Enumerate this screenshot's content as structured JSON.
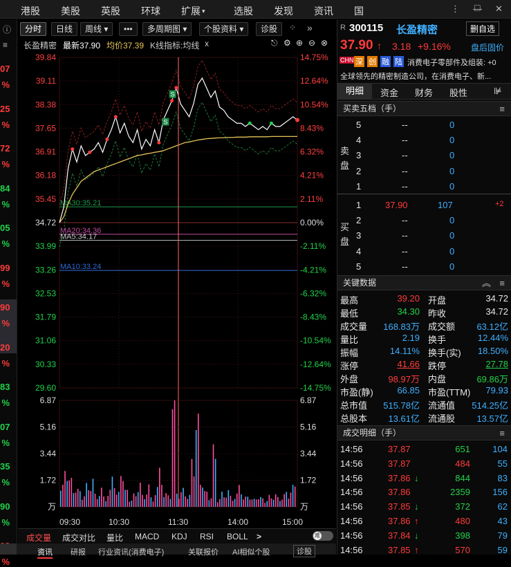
{
  "topnav": {
    "items": [
      "港股",
      "美股",
      "英股",
      "环球",
      "扩展",
      "选股",
      "发现",
      "资讯",
      "国"
    ],
    "window": {
      "min": "—",
      "max": "□",
      "close": "✕"
    }
  },
  "leftstrip": {
    "rows": [
      {
        "main": "07",
        "pct": "%",
        "color": "#ff3b3b"
      },
      {
        "main": "25",
        "pct": "%",
        "color": "#ff3b3b"
      },
      {
        "main": "72",
        "pct": "%",
        "color": "#ff3b3b"
      },
      {
        "main": "84",
        "pct": "%",
        "color": "#22d24a"
      },
      {
        "main": "05",
        "pct": "%",
        "color": "#22d24a"
      },
      {
        "main": "99",
        "pct": "%",
        "color": "#ff3b3b"
      },
      {
        "main": "90",
        "pct": "%",
        "color": "#ff3b3b"
      },
      {
        "main": "20",
        "pct": "%",
        "color": "#ff3b3b"
      },
      {
        "main": "83",
        "pct": "%",
        "color": "#22d24a"
      },
      {
        "main": "07",
        "pct": "%",
        "color": "#22d24a"
      },
      {
        "main": "35",
        "pct": "%",
        "color": "#22d24a"
      },
      {
        "main": "90",
        "pct": "%",
        "color": "#22d24a"
      },
      {
        "main": "03",
        "pct": "%",
        "color": "#ff3b3b"
      }
    ]
  },
  "toolbar": {
    "fenshi": "分时",
    "riline": "日线",
    "zhouxian": "周线 ▾",
    "more": "•••",
    "duozhouqi": "多周期图 ▾",
    "gegu": "个股资料 ▾",
    "zhengu": "诊股",
    "arrows": "⁘",
    "collapse": "»"
  },
  "infobar": {
    "name": "长盈精密",
    "latest": "最新37.90",
    "avg": "均价37.39",
    "indicator": "K线指标:均线",
    "close": "x",
    "icons": [
      "⎋",
      "⚙",
      "⊕",
      "⊖",
      "⊗"
    ]
  },
  "chart_data": {
    "type": "line",
    "title": "长盈精密 分时",
    "prev_close": 34.72,
    "y_left_ticks": [
      "39.84",
      "39.11",
      "38.38",
      "37.65",
      "36.91",
      "36.18",
      "35.45",
      "34.72",
      "33.99",
      "33.26",
      "32.53",
      "31.79",
      "31.06",
      "30.33",
      "29.60"
    ],
    "y_right_ticks": [
      "14.75%",
      "12.64%",
      "10.54%",
      "8.43%",
      "6.32%",
      "4.21%",
      "2.11%",
      "0.00%",
      "-2.11%",
      "-4.21%",
      "-6.32%",
      "-8.43%",
      "-10.54%",
      "-12.64%",
      "-14.75%"
    ],
    "ylim": [
      29.6,
      39.84
    ],
    "x_ticks": [
      "09:30",
      "10:30",
      "11:30",
      "14:00",
      "15:00"
    ],
    "ma_labels": {
      "ma30": "MA30:35.21",
      "ma20": "MA20:34.36",
      "ma5": "MA5:34.17",
      "ma10": "MA10:33.24"
    },
    "ma_values": {
      "ma30": 35.21,
      "ma20": 34.36,
      "ma5": 34.17,
      "ma10": 33.24
    },
    "price": [
      34.72,
      35.2,
      36.4,
      37.0,
      36.6,
      37.1,
      36.8,
      36.9,
      37.0,
      37.2,
      36.9,
      37.3,
      37.6,
      38.0,
      37.5,
      37.8,
      37.4,
      37.2,
      37.6,
      37.0,
      37.3,
      37.1,
      37.6,
      37.2,
      37.9,
      38.2,
      38.5,
      38.9,
      38.4,
      38.2,
      38.0,
      38.4,
      39.0,
      39.2,
      38.9,
      38.6,
      38.8,
      38.3,
      38.2,
      38.0,
      37.9,
      37.8,
      37.8,
      37.7,
      37.8,
      37.7,
      37.6,
      37.7,
      37.6,
      37.8,
      37.7,
      37.7,
      37.8,
      37.9,
      38.0,
      37.9
    ],
    "avg": [
      34.72,
      34.9,
      35.3,
      35.6,
      35.8,
      36.0,
      36.1,
      36.2,
      36.3,
      36.35,
      36.4,
      36.45,
      36.5,
      36.55,
      36.6,
      36.65,
      36.7,
      36.75,
      36.8,
      36.82,
      36.85,
      36.87,
      36.9,
      36.92,
      36.95,
      37.0,
      37.05,
      37.1,
      37.15,
      37.2,
      37.22,
      37.25,
      37.28,
      37.3,
      37.32,
      37.33,
      37.34,
      37.35,
      37.35,
      37.36,
      37.36,
      37.37,
      37.37,
      37.37,
      37.38,
      37.38,
      37.38,
      37.38,
      37.38,
      37.39,
      37.39,
      37.39,
      37.39,
      37.39,
      37.39,
      37.39
    ],
    "volume_ticks": [
      "6.87",
      "5.16",
      "3.44",
      "1.72",
      "万"
    ],
    "volume_max": 6.87,
    "volume": [
      1.3,
      3.2,
      1.8,
      1.5,
      1.1,
      0.9,
      1.4,
      2.0,
      0.8,
      1.2,
      0.7,
      1.0,
      2.4,
      0.9,
      3.0,
      1.1,
      0.6,
      0.8,
      1.9,
      0.7,
      1.5,
      0.6,
      1.2,
      2.8,
      0.8,
      1.0,
      6.8,
      1.4,
      0.9,
      1.3,
      0.7,
      3.9,
      5.6,
      2.2,
      1.0,
      0.8,
      3.7,
      0.6,
      0.9,
      1.1,
      0.7,
      0.8,
      1.6,
      0.6,
      0.9,
      0.5,
      0.8,
      0.6,
      0.5,
      0.7,
      0.9,
      0.6,
      0.8,
      1.0,
      1.3,
      1.6
    ]
  },
  "bottomtabs": {
    "items": [
      "成交量",
      "成交对比",
      "量比",
      "MACD",
      "KDJ",
      "RSI",
      "BOLL",
      ">"
    ],
    "toggle": "难"
  },
  "bottombar": {
    "items": [
      "资讯",
      "研报",
      "行业资讯(消费电子)",
      "关联报价",
      "AI相似个股",
      "诊股"
    ]
  },
  "right": {
    "code": "300115",
    "name": "长盈精密",
    "prefix": "R",
    "del_btn": "删自选",
    "price": "37.90",
    "arrow": "↑",
    "change": "3.18",
    "pct": "+9.16%",
    "after_hours": "盘后固价",
    "tags": [
      "CHN",
      "深",
      "创",
      "融",
      "陆"
    ],
    "ticker_text": "消费电子零部件及组装: +0",
    "desc": "全球领先的精密制造公司，在消费电子、新...",
    "tabs": [
      "明细",
      "资金",
      "财务",
      "股性",
      "⊯"
    ],
    "ob_title": "买卖五档（手）",
    "sell": [
      {
        "lvl": "5",
        "price": "--",
        "vol": "0"
      },
      {
        "lvl": "4",
        "price": "--",
        "vol": "0"
      },
      {
        "lvl": "3",
        "price": "--",
        "vol": "0"
      },
      {
        "lvl": "2",
        "price": "--",
        "vol": "0"
      },
      {
        "lvl": "1",
        "price": "--",
        "vol": "0"
      }
    ],
    "buy": [
      {
        "lvl": "1",
        "price": "37.90",
        "vol": "107",
        "chg": "+2"
      },
      {
        "lvl": "2",
        "price": "--",
        "vol": "0",
        "chg": ""
      },
      {
        "lvl": "3",
        "price": "--",
        "vol": "0",
        "chg": ""
      },
      {
        "lvl": "4",
        "price": "--",
        "vol": "0",
        "chg": ""
      },
      {
        "lvl": "5",
        "price": "--",
        "vol": "0",
        "chg": ""
      }
    ],
    "sell_label": "卖盘",
    "buy_label": "买盘",
    "kd_title": "关键数据",
    "kd": [
      {
        "l1": "最高",
        "v1": "39.20",
        "c1": "red",
        "l2": "开盘",
        "v2": "34.72",
        "c2": "white"
      },
      {
        "l1": "最低",
        "v1": "34.30",
        "c1": "green",
        "l2": "昨收",
        "v2": "34.72",
        "c2": "white"
      },
      {
        "l1": "成交量",
        "v1": "168.83万",
        "c1": "cyan",
        "l2": "成交额",
        "v2": "63.12亿",
        "c2": "cyan"
      },
      {
        "l1": "量比",
        "v1": "2.19",
        "c1": "cyan",
        "l2": "换手",
        "v2": "12.44%",
        "c2": "cyan"
      },
      {
        "l1": "振幅",
        "v1": "14.11%",
        "c1": "cyan",
        "l2": "换手(实)",
        "v2": "18.50%",
        "c2": "cyan"
      },
      {
        "l1": "涨停",
        "v1": "41.66",
        "c1": "red",
        "l2": "跌停",
        "v2": "27.78",
        "c2": "green"
      },
      {
        "l1": "外盘",
        "v1": "98.97万",
        "c1": "red",
        "l2": "内盘",
        "v2": "69.86万",
        "c2": "green"
      },
      {
        "l1": "市盈(静)",
        "v1": "66.85",
        "c1": "cyan",
        "l2": "市盈(TTM)",
        "v2": "79.93",
        "c2": "cyan"
      },
      {
        "l1": "总市值",
        "v1": "515.78亿",
        "c1": "cyan",
        "l2": "流通值",
        "v2": "514.25亿",
        "c2": "cyan"
      },
      {
        "l1": "总股本",
        "v1": "13.61亿",
        "c1": "cyan",
        "l2": "流通股",
        "v2": "13.57亿",
        "c2": "cyan"
      }
    ],
    "ticks_title": "成交明细（手）",
    "ticks": [
      {
        "t": "14:56",
        "p": "37.87",
        "d": "",
        "v": "651",
        "vc": "green",
        "n": "104"
      },
      {
        "t": "14:56",
        "p": "37.87",
        "d": "",
        "v": "484",
        "vc": "red",
        "n": "55"
      },
      {
        "t": "14:56",
        "p": "37.86",
        "d": "↓",
        "v": "844",
        "vc": "green",
        "n": "83"
      },
      {
        "t": "14:56",
        "p": "37.86",
        "d": "",
        "v": "2359",
        "vc": "green",
        "n": "156"
      },
      {
        "t": "14:56",
        "p": "37.85",
        "d": "↓",
        "v": "372",
        "vc": "green",
        "n": "62"
      },
      {
        "t": "14:56",
        "p": "37.86",
        "d": "↑",
        "v": "480",
        "vc": "red",
        "n": "43"
      },
      {
        "t": "14:56",
        "p": "37.84",
        "d": "↓",
        "v": "398",
        "vc": "green",
        "n": "79"
      },
      {
        "t": "14:56",
        "p": "37.85",
        "d": "↑",
        "v": "570",
        "vc": "red",
        "n": "59"
      }
    ]
  }
}
